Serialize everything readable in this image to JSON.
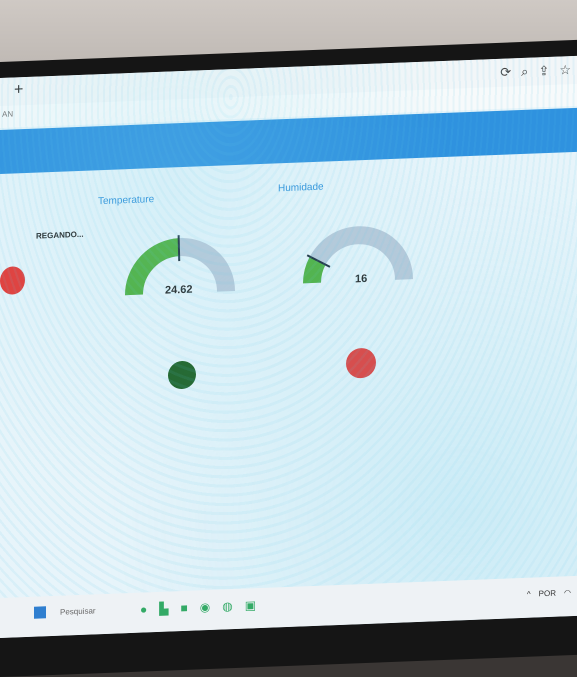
{
  "browser": {
    "new_tab_label": "+",
    "address_fragment": "AN",
    "toolbar_icons": [
      "refresh-icon",
      "zoom-icon",
      "share-icon",
      "star-icon"
    ]
  },
  "dashboard": {
    "status_text": "REGANDO...",
    "gauges": [
      {
        "title": "Temperature",
        "value_text": "24.62",
        "value": 24.62,
        "min": 0,
        "max": 50,
        "fill_color": "#4caf3a"
      },
      {
        "title": "Humidade",
        "value_text": "16",
        "value": 16,
        "min": 0,
        "max": 100,
        "fill_color": "#4caf3a"
      }
    ],
    "indicators": [
      {
        "name": "left-led",
        "color": "#e53935"
      },
      {
        "name": "temp-led",
        "color": "#1b5e20"
      },
      {
        "name": "humidity-led",
        "color": "#e53935"
      }
    ]
  },
  "taskbar": {
    "search_placeholder": "Pesquisar",
    "tray_text": "POR"
  },
  "colors": {
    "banner": "#2f92df",
    "gauge_track": "#b9c8d8",
    "gauge_fill": "#4caf3a"
  }
}
